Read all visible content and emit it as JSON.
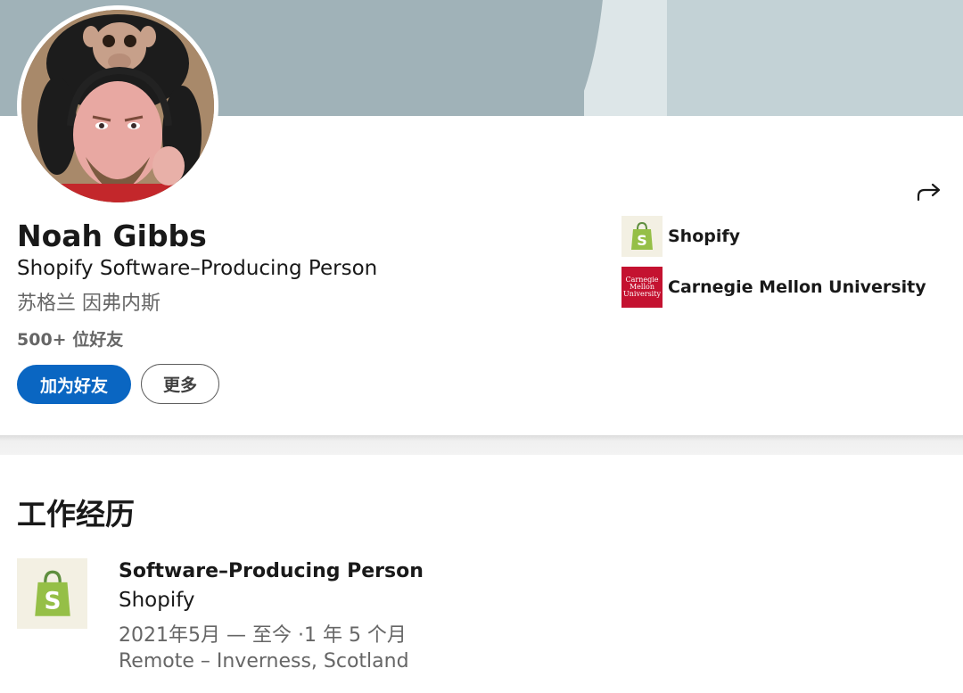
{
  "colors": {
    "primary": "#0a66c2",
    "banner": "#a0b2b8",
    "shopify_green": "#95bf47",
    "cmu_red": "#c41230",
    "secondary_text": "#666666"
  },
  "profile": {
    "name": "Noah Gibbs",
    "headline": "Shopify Software–Producing Person",
    "location": "苏格兰 因弗内斯",
    "connections": "500+ 位好友"
  },
  "actions": {
    "connect_label": "加为好友",
    "more_label": "更多",
    "share_icon": "share-arrow-icon"
  },
  "organizations": [
    {
      "name": "Shopify",
      "icon": "shopify-logo-icon"
    },
    {
      "name": "Carnegie Mellon University",
      "icon": "cmu-logo-icon",
      "logo_text": [
        "Carnegie",
        "Mellon",
        "University"
      ]
    }
  ],
  "experience": {
    "section_title": "工作经历",
    "items": [
      {
        "role": "Software–Producing Person",
        "company": "Shopify",
        "dates": "2021年5月 — 至今 ·1 年 5 个月",
        "place": "Remote – Inverness, Scotland",
        "icon": "shopify-logo-icon"
      }
    ]
  }
}
